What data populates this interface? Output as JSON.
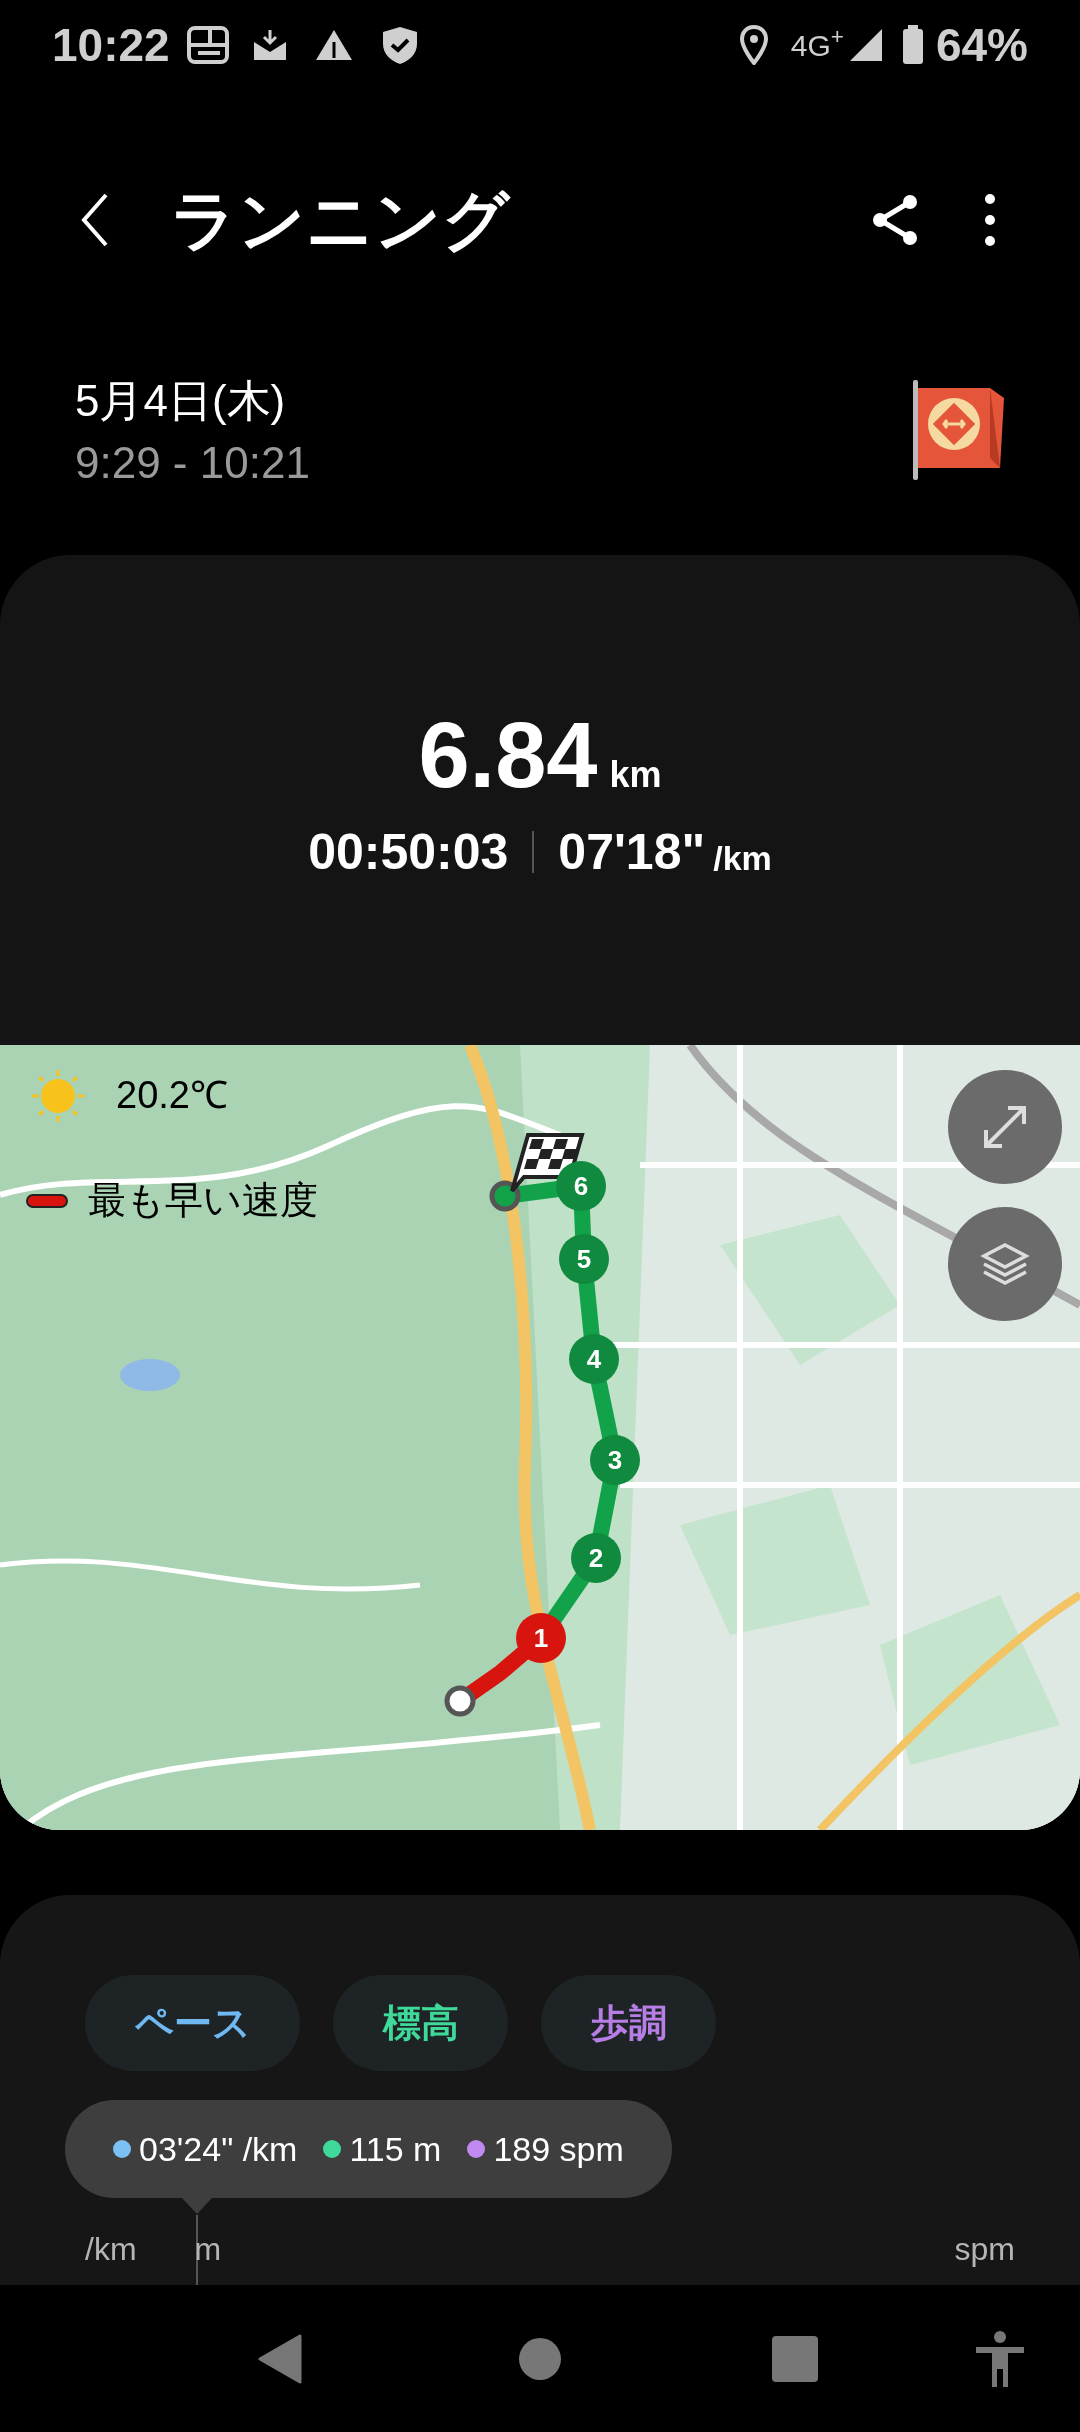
{
  "status_bar": {
    "time": "10:22",
    "network": "4G$^{+}$",
    "battery": "64%"
  },
  "header": {
    "title": "ランニング"
  },
  "session": {
    "date": "5月4日(木)",
    "time_range": "9:29 - 10:21"
  },
  "summary": {
    "distance": "6.84",
    "distance_unit": "km",
    "duration": "00:50:03",
    "pace": "07'18\"",
    "pace_unit": "/km"
  },
  "map": {
    "weather": "20.2℃",
    "legend": "最も早い速度",
    "markers": [
      {
        "label": "6",
        "color": "#0f8a3e"
      },
      {
        "label": "5",
        "color": "#0f8a3e"
      },
      {
        "label": "4",
        "color": "#0f8a3e"
      },
      {
        "label": "3",
        "color": "#0f8a3e"
      },
      {
        "label": "2",
        "color": "#0f8a3e"
      },
      {
        "label": "1",
        "color": "#d8140f"
      }
    ]
  },
  "chart": {
    "tabs": [
      {
        "label": "ペース",
        "selected": true,
        "color": "#6fb8f2"
      },
      {
        "label": "標高",
        "selected": true,
        "color": "#3fd99a"
      },
      {
        "label": "歩調",
        "selected": true,
        "color": "#b77ee6"
      }
    ],
    "tooltip": [
      {
        "text": "03'24\" /km",
        "color": "#7cc1f5"
      },
      {
        "text": "115 m",
        "color": "#3fd99a"
      },
      {
        "text": "189 spm",
        "color": "#c08af0"
      }
    ],
    "axis_labels": [
      "/km",
      "m",
      "spm"
    ]
  }
}
